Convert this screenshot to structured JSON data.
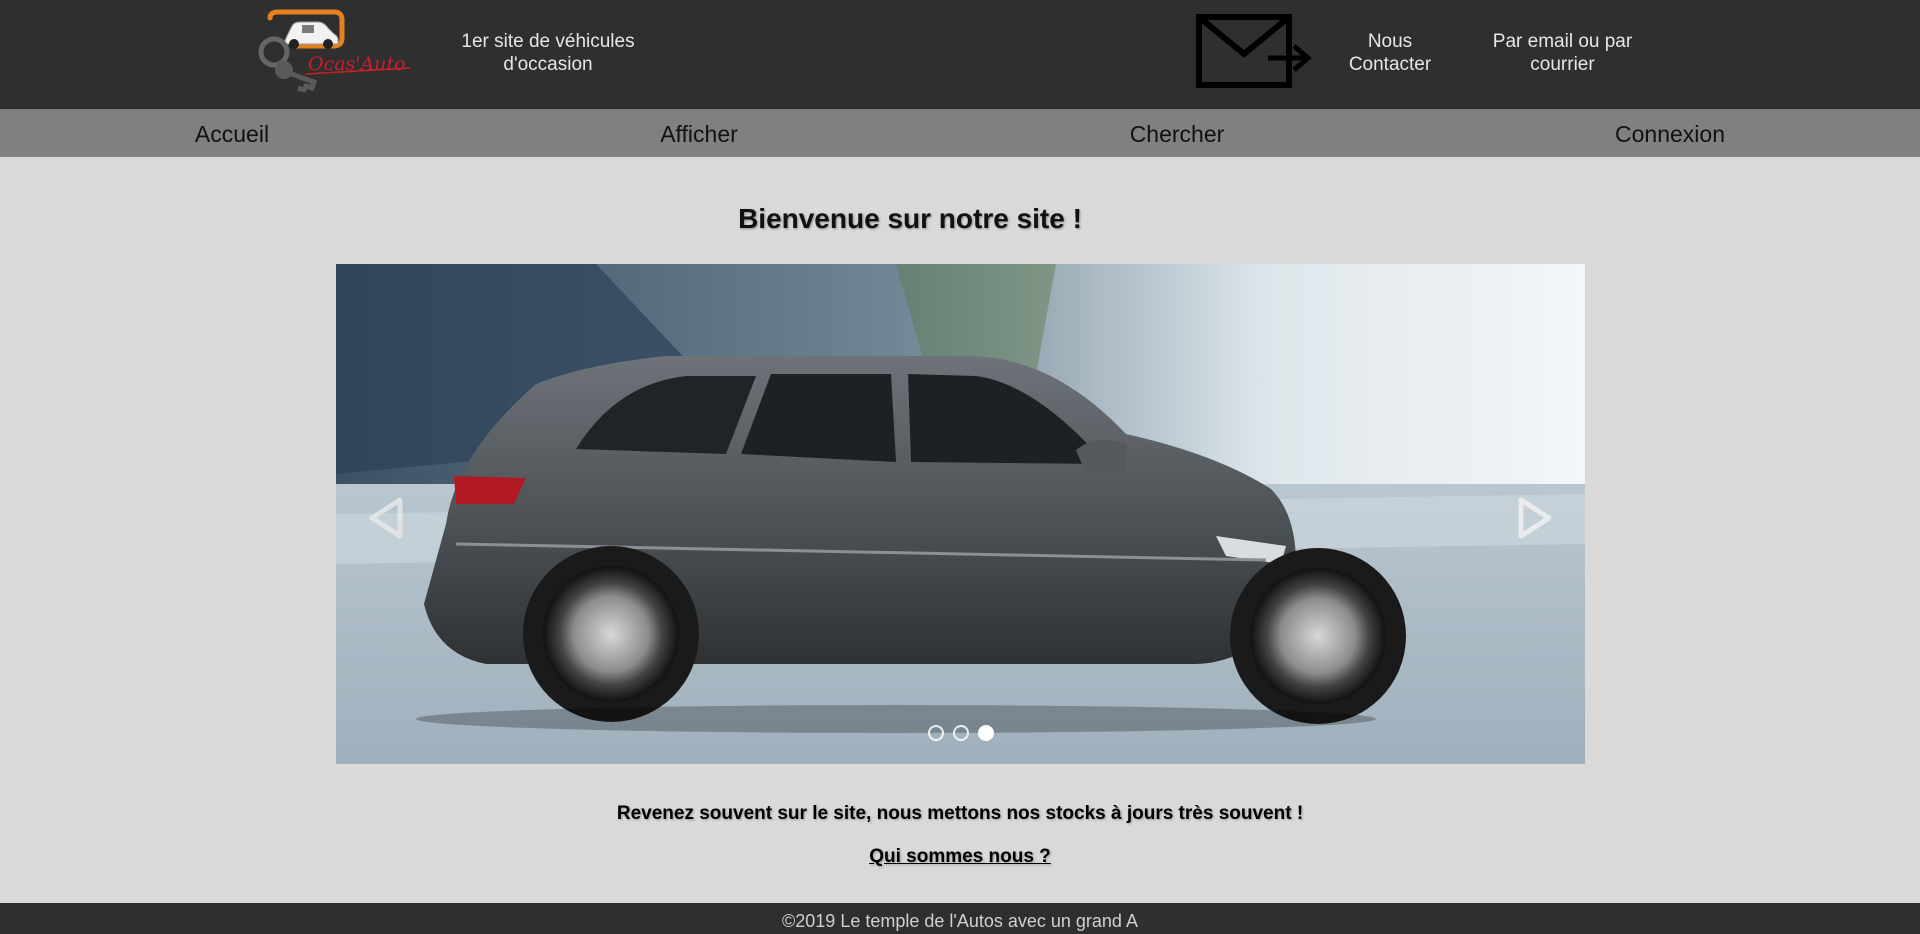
{
  "header": {
    "logo_text": "Ocas'Auto",
    "tagline_line1": "1er site de véhicules",
    "tagline_line2": "d'occasion",
    "contact_line1": "Nous",
    "contact_line2": "Contacter",
    "contact_info_line1": "Par email ou par",
    "contact_info_line2": "courrier",
    "mail_icon": "envelope-arrow-icon"
  },
  "nav": {
    "items": [
      {
        "label": "Accueil"
      },
      {
        "label": "Afficher"
      },
      {
        "label": "Chercher"
      },
      {
        "label": "Connexion"
      }
    ]
  },
  "main": {
    "title": "Bienvenue sur notre site !",
    "slider": {
      "prev_icon": "triangle-left-icon",
      "next_icon": "triangle-right-icon",
      "slide_count": 3,
      "active_slide": 3
    },
    "message": "Revenez souvent sur le site, nous mettons nos stocks à jours très souvent !",
    "about_link": "Qui sommes nous ?"
  },
  "footer": {
    "text": "©2019 Le temple de l'Autos avec un grand A"
  },
  "colors": {
    "header_bg": "#2f2f2f",
    "nav_bg": "#808080",
    "page_bg": "#d9d9d9",
    "logo_orange": "#e5801f",
    "logo_red": "#c8202a"
  }
}
